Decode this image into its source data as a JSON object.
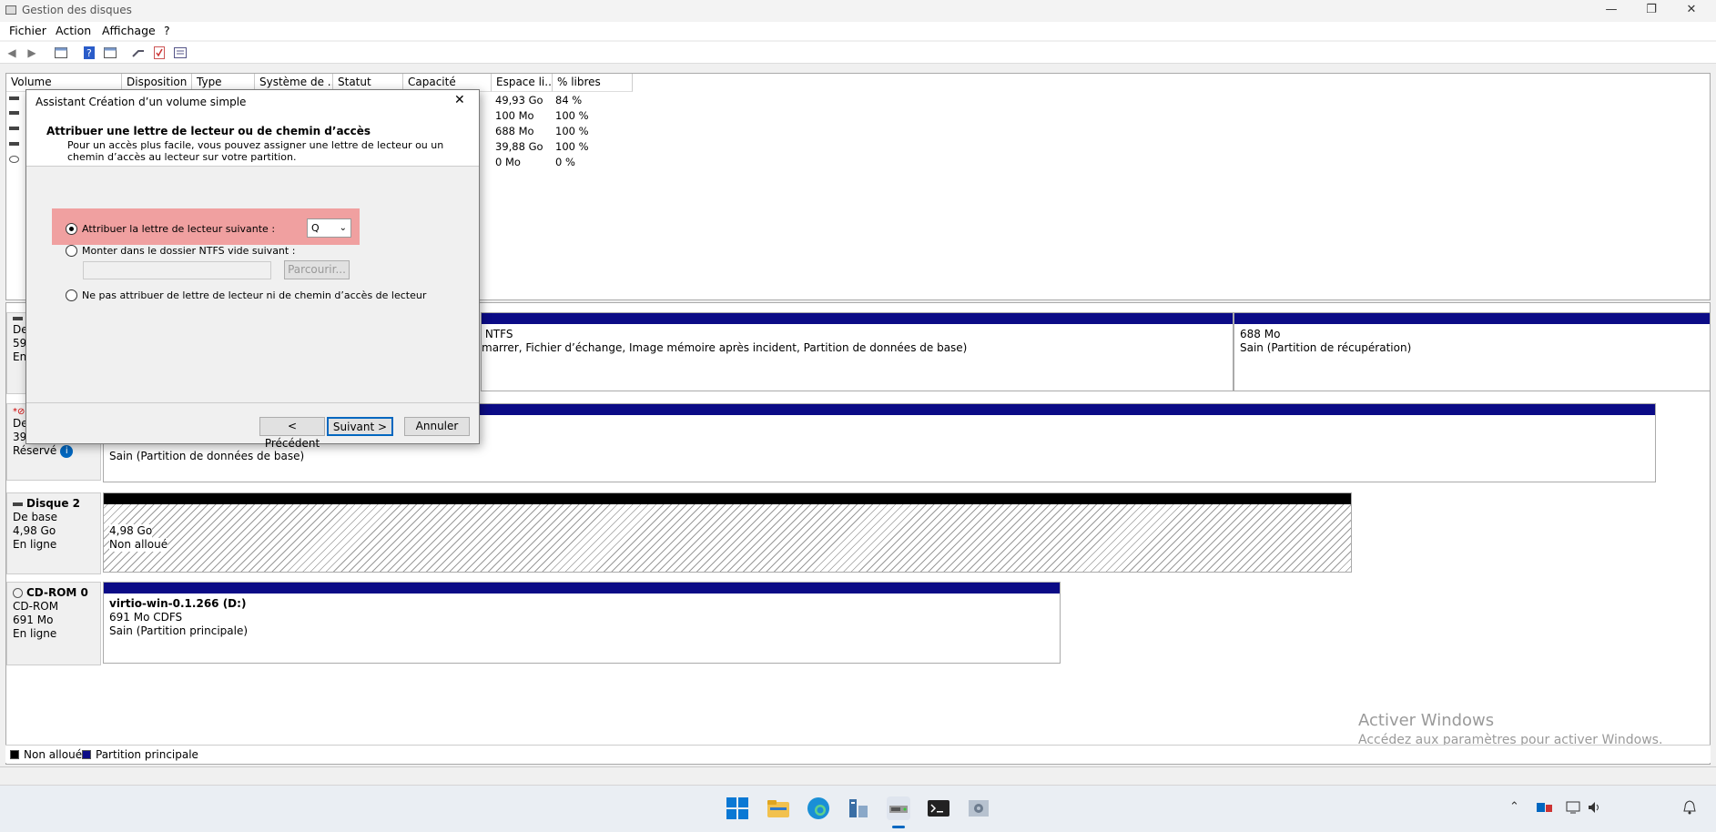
{
  "window": {
    "title": "Gestion des disques",
    "minimize": "—",
    "maximize": "❐",
    "close": "✕"
  },
  "menu": [
    "Fichier",
    "Action",
    "Affichage",
    "?"
  ],
  "volume_table": {
    "headers": [
      "Volume",
      "Disposition",
      "Type",
      "Système de ...",
      "Statut",
      "Capacité",
      "Espace li...",
      "% libres"
    ],
    "rows": [
      {
        "free": "49,93 Go",
        "pct": "84 %"
      },
      {
        "free": "100 Mo",
        "pct": "100 %"
      },
      {
        "free": "688 Mo",
        "pct": "100 %"
      },
      {
        "free": "39,88 Go",
        "pct": "100 %"
      },
      {
        "free": "0 Mo",
        "pct": "0 %"
      }
    ]
  },
  "disks": {
    "disk0": {
      "info": [
        "De",
        "59,",
        "En"
      ],
      "part_main_line1": " NTFS",
      "part_main_line2": "marrer, Fichier d’échange, Image mémoire après incident, Partition de données de base)",
      "part_recovery_size": "688 Mo",
      "part_recovery_status": "Sain (Partition de récupération)"
    },
    "disk1": {
      "info": [
        "De",
        "39,",
        "Réservé"
      ],
      "part_status": "Sain (Partition de données de base)"
    },
    "disk2": {
      "name": "Disque 2",
      "type": "De base",
      "size": "4,98 Go",
      "state": "En ligne",
      "part_size": "4,98 Go",
      "part_status": "Non alloué"
    },
    "cdrom0": {
      "name": "CD-ROM 0",
      "type": "CD-ROM",
      "size": "691 Mo",
      "state": "En ligne",
      "part_name": "virtio-win-0.1.266  (D:)",
      "part_fs": "691 Mo CDFS",
      "part_status": "Sain (Partition principale)"
    }
  },
  "legend": {
    "unallocated": "Non alloué",
    "primary": "Partition principale"
  },
  "watermark": {
    "line1": "Activer Windows",
    "line2": "Accédez aux paramètres pour activer Windows."
  },
  "dialog": {
    "title": "Assistant Création d’un volume simple",
    "heading": "Attribuer une lettre de lecteur ou de chemin d’accès",
    "description_line1": "Pour un accès plus facile, vous pouvez assigner une lettre de lecteur ou un",
    "description_line2": "chemin d’accès au lecteur sur votre partition.",
    "option_assign": "Attribuer la lettre de lecteur suivante :",
    "drive_letter": "Q",
    "option_mount": "Monter dans le dossier NTFS vide suivant :",
    "folder_value": "",
    "browse": "Parcourir...",
    "option_none": "Ne pas attribuer de lettre de lecteur ni de chemin d’accès de lecteur",
    "btn_back": "< Précédent",
    "btn_next": "Suivant >",
    "btn_cancel": "Annuler"
  },
  "colors": {
    "partition_bar": "#0b0b86",
    "highlight": "#f0a0a0",
    "accent": "#0067c0"
  }
}
